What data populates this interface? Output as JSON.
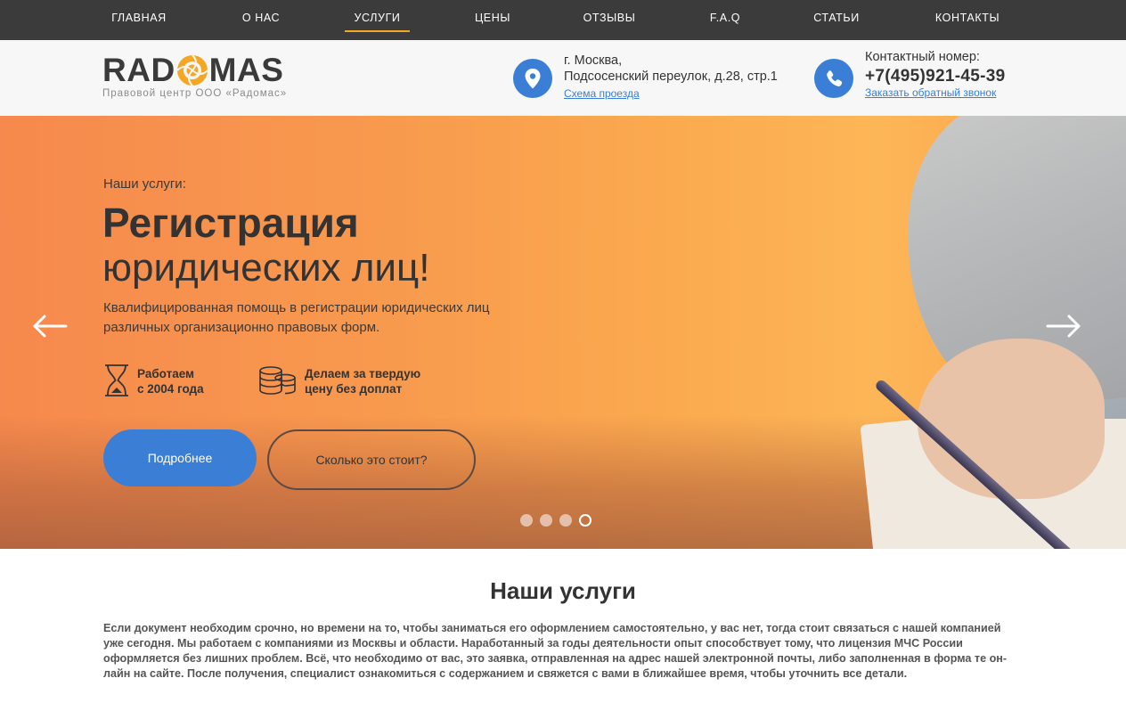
{
  "nav": {
    "items": [
      {
        "label": "ГЛАВНАЯ",
        "active": false
      },
      {
        "label": "О НАС",
        "active": false
      },
      {
        "label": "УСЛУГИ",
        "active": true
      },
      {
        "label": "ЦЕНЫ",
        "active": false
      },
      {
        "label": "ОТЗЫВЫ",
        "active": false
      },
      {
        "label": "F.A.Q",
        "active": false
      },
      {
        "label": "СТАТЬИ",
        "active": false
      },
      {
        "label": "КОНТАКТЫ",
        "active": false
      }
    ],
    "active_color": "#f5a623"
  },
  "header": {
    "logo_left": "RAD",
    "logo_right": "MAS",
    "logo_icon": "sun-o-icon",
    "tagline": "Правовой центр ООО «Радомас»",
    "address_icon": "map-pin-icon",
    "address_line1": "г. Москва,",
    "address_line2": "Подсосенский переулок, д.28, стр.1",
    "map_link": "Схема проезда",
    "phone_icon": "phone-icon",
    "phone_label": "Контактный номер:",
    "phone": "+7(495)921-45-39",
    "callback_link": "Заказать обратный звонок",
    "accent_color": "#3a7fd5"
  },
  "hero": {
    "subtitle": "Наши услуги:",
    "title_bold": "Регистрация",
    "title_light": "юридических лиц!",
    "description": "Квалифицированная помощь в регистрации юридических лиц различных организационно правовых форм.",
    "features": [
      {
        "icon": "hourglass-icon",
        "line1": "Работаем",
        "line2": "с 2004 года"
      },
      {
        "icon": "coins-icon",
        "line1": "Делаем за твердую",
        "line2": "цену без доплат"
      }
    ],
    "primary_button": "Подробнее",
    "secondary_button": "Сколько это стоит?",
    "prev_icon": "arrow-left-icon",
    "next_icon": "arrow-right-icon",
    "slides_total": 4,
    "active_slide": 4
  },
  "services": {
    "title": "Наши услуги",
    "text": "Если документ необходим срочно, но времени на то, чтобы заниматься его оформлением самостоятельно, у вас нет, тогда стоит связаться с нашей компанией уже сегодня. Мы работаем с компаниями из Москвы и области. Наработанный за годы деятельности опыт способствует тому, что лицензия МЧС России оформляется без лишних проблем. Всё, что необходимо от вас, это заявка, отправленная на адрес нашей электронной почты, либо заполненная в форма те он-лайн на сайте. После получения, специалист ознакомиться с содержанием и свяжется с вами в ближайшее время, чтобы уточнить все детали."
  }
}
